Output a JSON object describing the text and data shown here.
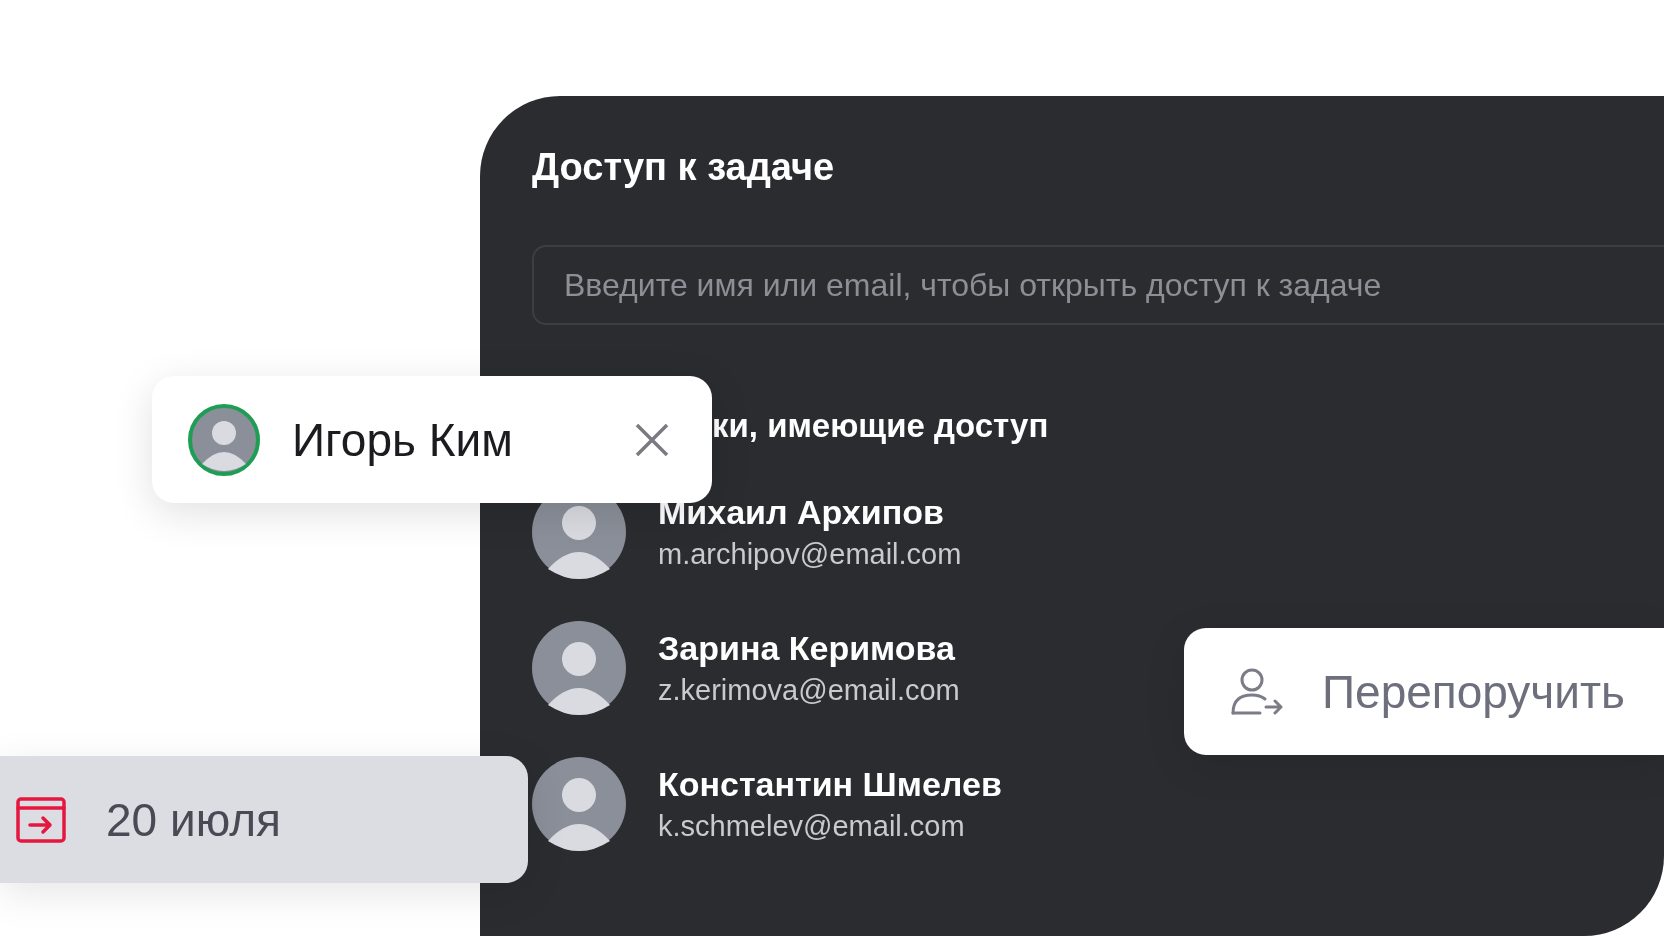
{
  "panel": {
    "title": "Доступ к задаче",
    "search": {
      "placeholder": "Введите имя или email, чтобы открыть доступ к задаче"
    },
    "section_heading": "ки, имеющие доступ",
    "people": [
      {
        "name": "Михаил Архипов",
        "email": "m.archipov@email.com"
      },
      {
        "name": "Зарина Керимова",
        "email": "z.kerimova@email.com"
      },
      {
        "name": "Константин Шмелев",
        "email": "k.schmelev@email.com"
      }
    ]
  },
  "assignee_chip": {
    "name": "Игорь Ким"
  },
  "reassign_button": {
    "label": "Перепоручить"
  },
  "date_chip": {
    "label": "20 июля"
  }
}
